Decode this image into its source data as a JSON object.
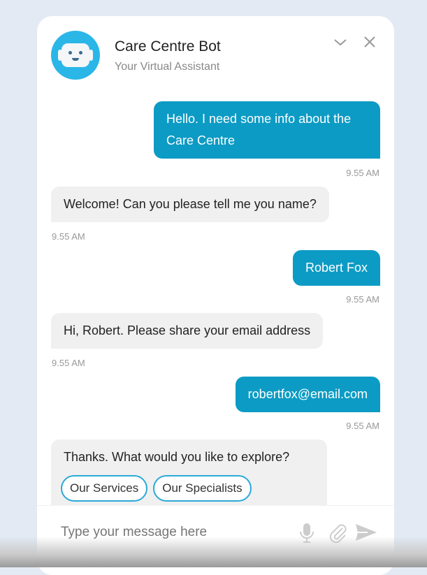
{
  "header": {
    "title": "Care Centre Bot",
    "subtitle": "Your Virtual Assistant",
    "icons": [
      "robot-avatar",
      "chevron-down-icon",
      "close-icon"
    ]
  },
  "messages": [
    {
      "from": "user",
      "text": "Hello. I need some info about the Care Centre",
      "time": "9.55 AM"
    },
    {
      "from": "bot",
      "text": "Welcome! Can you please tell me you name?",
      "time": "9.55 AM"
    },
    {
      "from": "user",
      "text": "Robert Fox",
      "time": "9.55 AM"
    },
    {
      "from": "bot",
      "text": "Hi, Robert. Please share your email address",
      "time": "9.55 AM"
    },
    {
      "from": "user",
      "text": "robertfox@email.com",
      "time": "9.55 AM"
    },
    {
      "from": "bot",
      "text": "Thanks. What would you like to explore?",
      "options": [
        "Our Services",
        "Our Specialists"
      ]
    }
  ],
  "composer": {
    "placeholder": "Type your message here",
    "icons": [
      "microphone-icon",
      "paperclip-icon",
      "send-icon"
    ]
  },
  "colors": {
    "user_bubble": "#0c9bc4",
    "bot_bubble": "#f0f0f0",
    "accent": "#2bb6e8"
  }
}
